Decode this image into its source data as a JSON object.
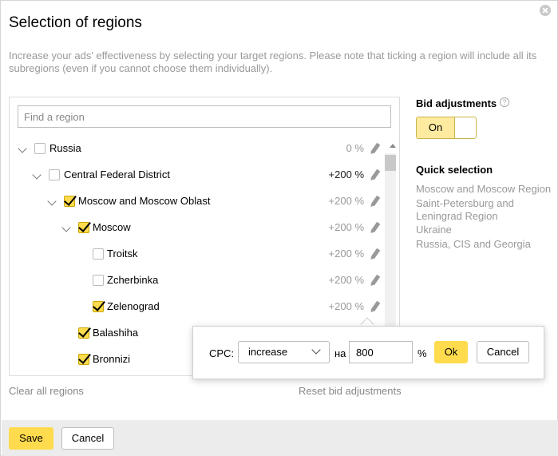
{
  "dialog": {
    "title": "Selection of regions",
    "description": "Increase your ads' effectiveness by selecting your target regions. Please note that ticking a region will include all its subregions (even if you cannot choose them individually)."
  },
  "search": {
    "placeholder": "Find a region",
    "value": ""
  },
  "regions": [
    {
      "label": "Russia",
      "checked": false,
      "percent": "0 %"
    },
    {
      "label": "Central Federal District",
      "checked": false,
      "percent": "+200 %"
    },
    {
      "label": "Moscow and Moscow Oblast",
      "checked": true,
      "percent": "+200 %"
    },
    {
      "label": "Moscow",
      "checked": true,
      "percent": "+200 %"
    },
    {
      "label": "Troitsk",
      "checked": false,
      "percent": "+200 %"
    },
    {
      "label": "Zcherbinka",
      "checked": false,
      "percent": "+200 %"
    },
    {
      "label": "Zelenograd",
      "checked": true,
      "percent": "+200 %"
    },
    {
      "label": "Balashiha",
      "checked": true,
      "percent": ""
    },
    {
      "label": "Bronnizi",
      "checked": true,
      "percent": ""
    }
  ],
  "bid_adjustments": {
    "title": "Bid adjustments",
    "help": "?",
    "toggle_label": "On",
    "state": "on"
  },
  "quick_selection": {
    "title": "Quick selection",
    "items": [
      "Moscow and Moscow Region",
      "Saint-Petersburg and Leningrad Region",
      "Ukraine",
      "Russia, CIS and Georgia"
    ]
  },
  "links": {
    "clear": "Clear all regions",
    "reset": "Reset bid adjustments"
  },
  "cpc_popup": {
    "label": "CPC:",
    "mode": "increase",
    "na": "на",
    "value": "800",
    "unit": "%",
    "ok": "Ok",
    "cancel": "Cancel"
  },
  "footer": {
    "save": "Save",
    "cancel": "Cancel"
  },
  "colors": {
    "accent_yellow": "#ffdb4d",
    "positive_percent": "#222222",
    "muted_text": "#999999"
  }
}
